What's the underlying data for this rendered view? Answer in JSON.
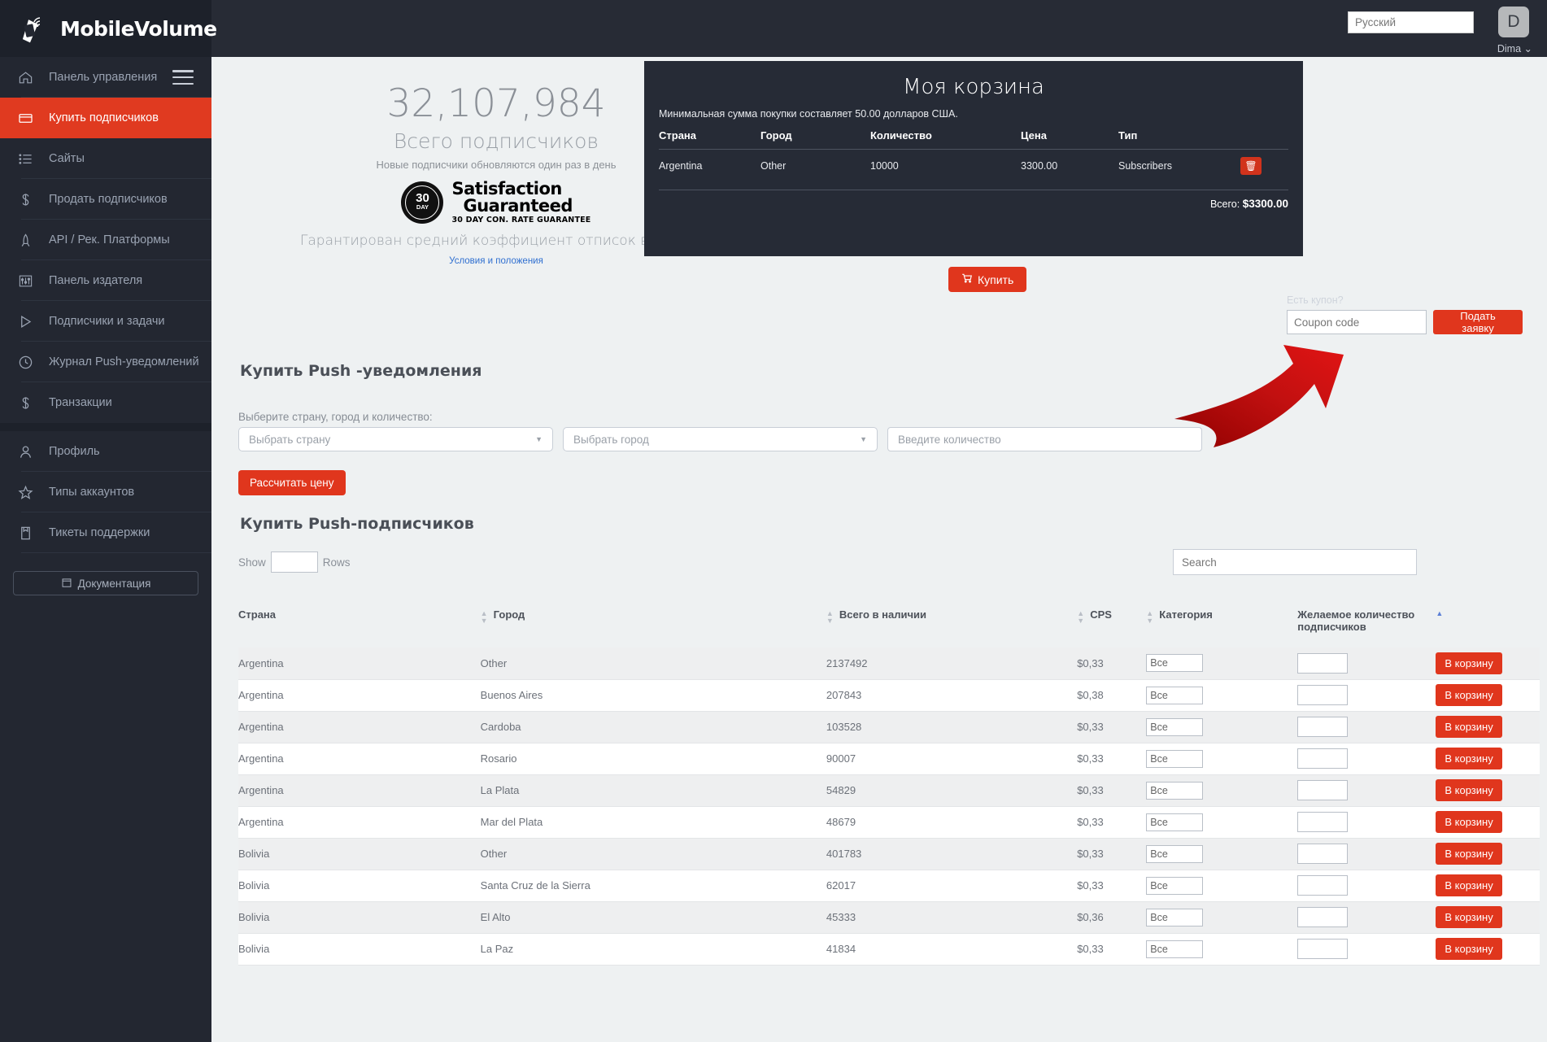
{
  "brand": {
    "name": "MobileVolume",
    "logo_icon": "mobile-phone-signal-icon"
  },
  "topbar": {
    "language_value": "Русский",
    "avatar_initial": "D",
    "user_name": "Dima ⌄"
  },
  "sidebar": {
    "items": [
      {
        "label": "Панель управления",
        "icon": "home-icon",
        "active": false
      },
      {
        "label": "Купить подписчиков",
        "icon": "card-icon",
        "active": true
      },
      {
        "label": "Сайты",
        "icon": "list-icon",
        "active": false
      },
      {
        "label": "Продать подписчиков",
        "icon": "dollar-icon",
        "active": false
      },
      {
        "label": "API / Рек. Платформы",
        "icon": "rocket-icon",
        "active": false
      },
      {
        "label": "Панель издателя",
        "icon": "sliders-icon",
        "active": false
      },
      {
        "label": "Подписчики и задачи",
        "icon": "play-icon",
        "active": false
      },
      {
        "label": "Журнал Push-уведомлений",
        "icon": "clock-icon",
        "active": false
      },
      {
        "label": "Транзакции",
        "icon": "dollar-icon",
        "active": false
      }
    ],
    "items2": [
      {
        "label": "Профиль",
        "icon": "user-icon"
      },
      {
        "label": "Типы аккаунтов",
        "icon": "star-icon"
      },
      {
        "label": "Тикеты поддержки",
        "icon": "book-icon"
      }
    ],
    "docs_label": "Документация",
    "docs_icon": "calendar-icon"
  },
  "hero": {
    "count": "32,107,984",
    "subtitle": "Всего подписчиков",
    "note": "Новые подписчики обновляются один раз в день",
    "badge_seal_number": "30",
    "badge_seal_unit": "DAY",
    "badge_line1": "Satisfaction",
    "badge_line2": "Guaranteed",
    "badge_line3": "30 DAY CON. RATE  GUARANTEE",
    "guarantee": "Гарантирован средний коэффициент отписок в день.",
    "terms": "Условия и положения"
  },
  "cart": {
    "title": "Моя корзина",
    "min_notice": "Минимальная сумма покупки составляет 50.00 долларов США.",
    "headers": [
      "Страна",
      "Город",
      "Количество",
      "Цена",
      "Тип",
      ""
    ],
    "rows": [
      {
        "country": "Argentina",
        "city": "Other",
        "quantity": "10000",
        "price": "3300.00",
        "type": "Subscribers",
        "delete_icon": "trash-icon"
      }
    ],
    "total_label": "Всего:",
    "total_value": "$3300.00",
    "buy_label": "Купить",
    "buy_icon": "cart-icon",
    "coupon_label": "Есть купон?",
    "coupon_placeholder": "Coupon code",
    "coupon_button": "Подать заявку",
    "accent_color": "#e0361d",
    "panel_color": "#262b36"
  },
  "buy_section": {
    "title": "Купить Push -уведомления",
    "label": "Выберите страну, город и количество:",
    "country_placeholder": "Выбрать страну",
    "city_placeholder": "Выбрать город",
    "quantity_placeholder": "Введите количество",
    "calculate_button": "Рассчитать цену"
  },
  "table_section": {
    "title": "Купить Push-подписчиков",
    "show_label": "Show",
    "rows_label": "Rows",
    "show_value": "",
    "search_placeholder": "Search",
    "headers": [
      "Страна",
      "Город",
      "Всего в наличии",
      "CPS",
      "Категория",
      "Желаемое количество подписчиков",
      ""
    ],
    "category_value": "Все",
    "add_button": "В корзину",
    "rows": [
      {
        "country": "Argentina",
        "city": "Other",
        "available": "2137492",
        "cps": "$0,33"
      },
      {
        "country": "Argentina",
        "city": "Buenos Aires",
        "available": "207843",
        "cps": "$0,38"
      },
      {
        "country": "Argentina",
        "city": "Cardoba",
        "available": "103528",
        "cps": "$0,33"
      },
      {
        "country": "Argentina",
        "city": "Rosario",
        "available": "90007",
        "cps": "$0,33"
      },
      {
        "country": "Argentina",
        "city": "La Plata",
        "available": "54829",
        "cps": "$0,33"
      },
      {
        "country": "Argentina",
        "city": "Mar del Plata",
        "available": "48679",
        "cps": "$0,33"
      },
      {
        "country": "Bolivia",
        "city": "Other",
        "available": "401783",
        "cps": "$0,33"
      },
      {
        "country": "Bolivia",
        "city": "Santa Cruz de la Sierra",
        "available": "62017",
        "cps": "$0,33"
      },
      {
        "country": "Bolivia",
        "city": "El Alto",
        "available": "45333",
        "cps": "$0,36"
      },
      {
        "country": "Bolivia",
        "city": "La Paz",
        "available": "41834",
        "cps": "$0,33"
      }
    ]
  },
  "annotation": {
    "arrow_icon": "curved-red-arrow-icon",
    "color": "#c00d0d"
  }
}
